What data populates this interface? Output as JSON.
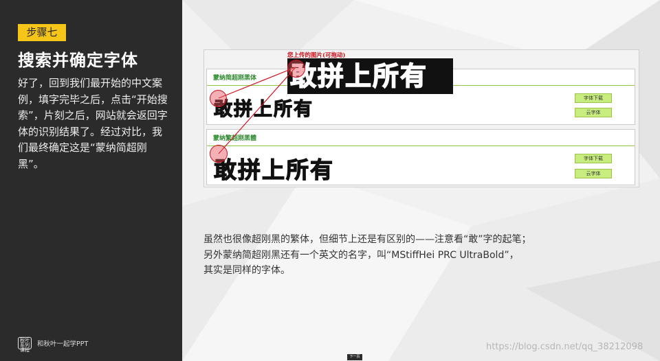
{
  "sidebar": {
    "step": "步骤七",
    "title": "搜索并确定字体",
    "description": "好了，回到我们最开始的中文案例，填字完毕之后，点击“开始搜索”，片刻之后，网站就会返回字体的识别结果了。经过对比，我们最终确定这是“蒙纳简超刚黑”。",
    "brand_logo": "秋叶系列课程",
    "brand_name": "和秋叶一起学PPT"
  },
  "screenshot": {
    "upload_label": "您上传的图片(可拖动)",
    "upload_text": "敢拼上所有",
    "results": [
      {
        "font_name": "蒙纳简超刚黑体",
        "preview": "敢拼上所有",
        "download_label": "字体下载",
        "cloud_label": "云字体"
      },
      {
        "font_name": "蒙纳繁超刚黑體",
        "preview": "敢拼上所有",
        "download_label": "字体下载",
        "cloud_label": "云字体"
      }
    ]
  },
  "caption": {
    "line1": "虽然也很像超刚黑的繁体，但细节上还是有区别的——注意看“敢”字的起笔；",
    "line2": "另外蒙纳简超刚黑还有一个英文的名字，叫“MStiffHei PRC UltraBold”，",
    "line3": "其实是同样的字体。"
  },
  "footer": {
    "next_label": "下一页",
    "watermark": "https://blog.csdn.net/qq_38212098"
  },
  "colors": {
    "sidebar_bg": "#2b2b2b",
    "badge": "#f5c518",
    "font_name_green": "#2f8a2f",
    "button_green": "#c9ec7e",
    "marker_red": "#d0101b"
  }
}
